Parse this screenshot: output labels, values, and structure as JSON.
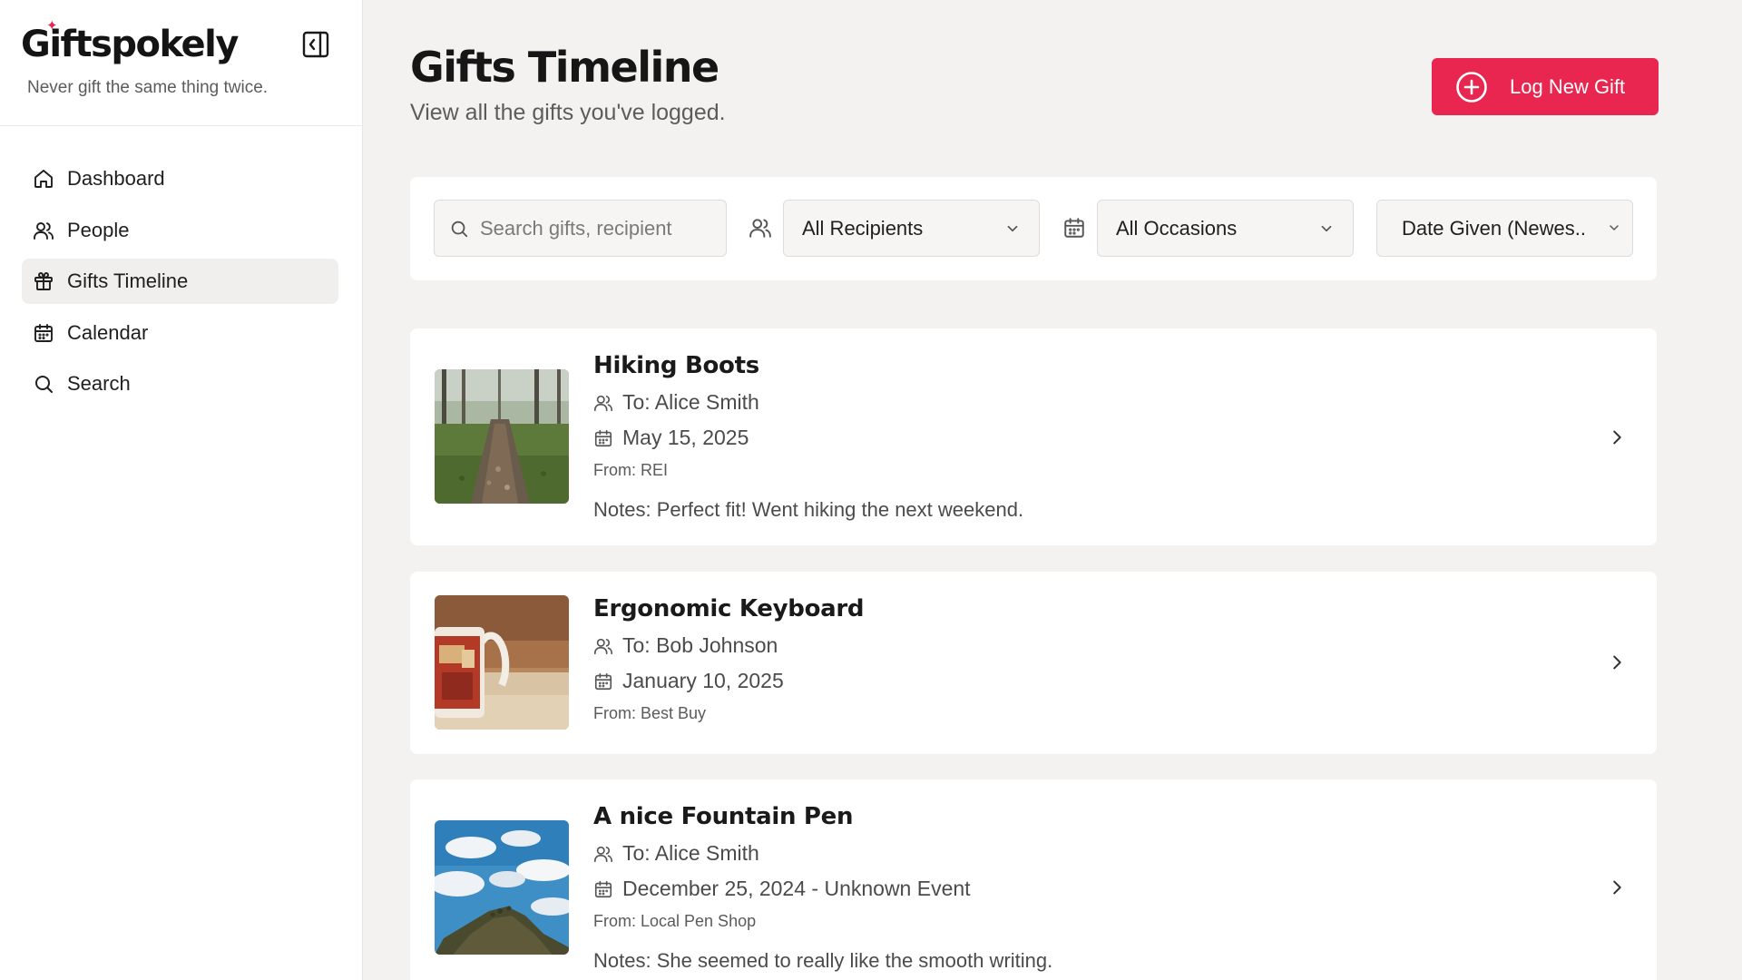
{
  "app": {
    "name": "Giftspokely",
    "tagline": "Never gift the same thing twice."
  },
  "sidebar": {
    "items": [
      {
        "label": "Dashboard",
        "icon": "home-icon",
        "active": false
      },
      {
        "label": "People",
        "icon": "users-icon",
        "active": false
      },
      {
        "label": "Gifts Timeline",
        "icon": "gift-icon",
        "active": true
      },
      {
        "label": "Calendar",
        "icon": "calendar-icon",
        "active": false
      },
      {
        "label": "Search",
        "icon": "search-icon",
        "active": false
      }
    ]
  },
  "header": {
    "title": "Gifts Timeline",
    "subtitle": "View all the gifts you've logged.",
    "log_button_label": "Log New Gift"
  },
  "filters": {
    "search_placeholder": "Search gifts, recipient",
    "recipient_value": "All Recipients",
    "occasion_value": "All Occasions",
    "sort_value": "Date Given (Newes.."
  },
  "gifts": [
    {
      "title": "Hiking Boots",
      "to": "To: Alice Smith",
      "date": "May 15, 2025",
      "from": "From: REI",
      "notes": "Notes: Perfect fit! Went hiking the next weekend."
    },
    {
      "title": "Ergonomic Keyboard",
      "to": "To: Bob Johnson",
      "date": "January 10, 2025",
      "from": "From: Best Buy",
      "notes": ""
    },
    {
      "title": "A nice Fountain Pen",
      "to": "To: Alice Smith",
      "date": "December 25, 2024 - Unknown Event",
      "from": "From: Local Pen Shop",
      "notes": "Notes: She seemed to really like the smooth writing."
    }
  ],
  "colors": {
    "accent": "#e8264f",
    "background": "#f3f2f1",
    "active_nav": "#f0efed"
  }
}
